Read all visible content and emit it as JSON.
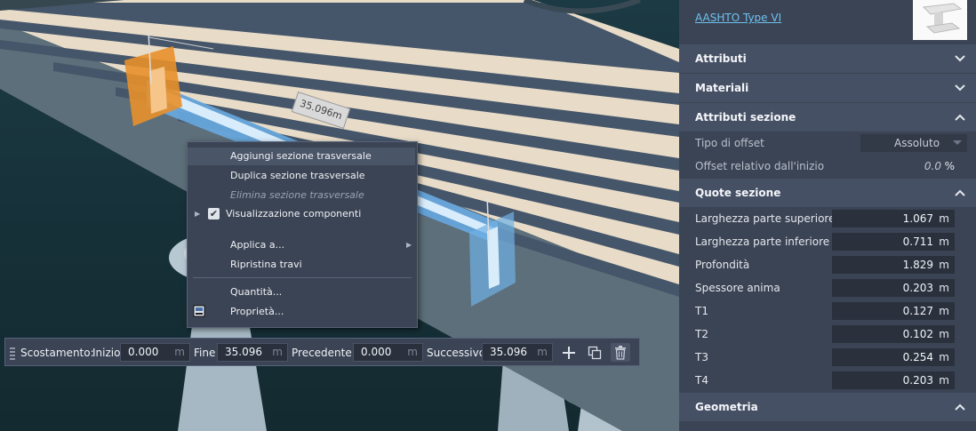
{
  "viewport": {
    "dimension_label": "35.096m"
  },
  "context_menu": {
    "items": [
      {
        "label": "Aggiungi sezione trasversale"
      },
      {
        "label": "Duplica sezione trasversale"
      },
      {
        "label": "Elimina sezione trasversale"
      },
      {
        "label": "Visualizzazione componenti"
      },
      {
        "label": "Applica a..."
      },
      {
        "label": "Ripristina travi"
      },
      {
        "label": "Quantità..."
      },
      {
        "label": "Proprietà..."
      }
    ]
  },
  "toolbar": {
    "offset_label": "Scostamento:",
    "start_label": "Inizio",
    "start_value": "0.000",
    "end_label": "Fine",
    "end_value": "35.096",
    "prev_label": "Precedente",
    "prev_value": "0.000",
    "next_label": "Successivo",
    "next_value": "35.096",
    "unit": "m"
  },
  "panel": {
    "type_link": "AASHTO Type VI",
    "sections": {
      "attributes": "Attributi",
      "materials": "Materiali",
      "section_attributes": "Attributi sezione",
      "section_dims": "Quote sezione",
      "geometry": "Geometria"
    },
    "offset_type_label": "Tipo di offset",
    "offset_type_value": "Assoluto",
    "rel_offset_label": "Offset relativo dall'inizio",
    "rel_offset_value": "0.0",
    "rel_offset_unit": "%",
    "dims": [
      {
        "label": "Larghezza parte superiore",
        "value": "1.067",
        "unit": "m"
      },
      {
        "label": "Larghezza parte inferiore",
        "value": "0.711",
        "unit": "m"
      },
      {
        "label": "Profondità",
        "value": "1.829",
        "unit": "m"
      },
      {
        "label": "Spessore anima",
        "value": "0.203",
        "unit": "m"
      },
      {
        "label": "T1",
        "value": "0.127",
        "unit": "m"
      },
      {
        "label": "T2",
        "value": "0.102",
        "unit": "m"
      },
      {
        "label": "T3",
        "value": "0.254",
        "unit": "m"
      },
      {
        "label": "T4",
        "value": "0.203",
        "unit": "m"
      }
    ]
  }
}
